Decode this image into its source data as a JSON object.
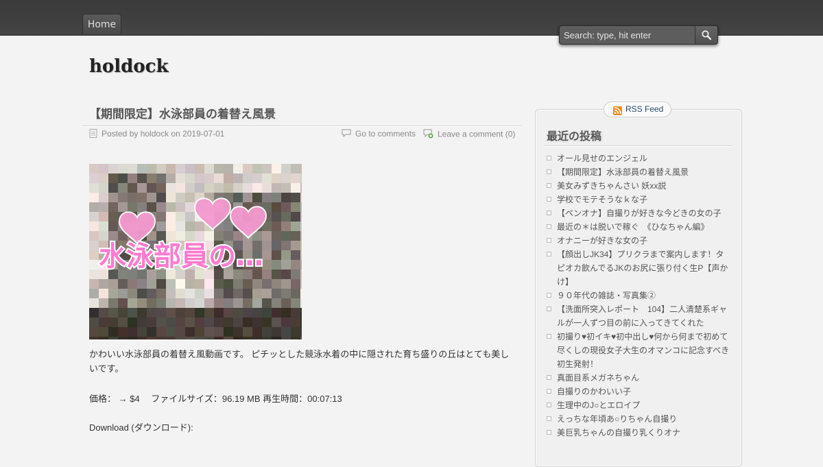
{
  "nav": {
    "home": "Home"
  },
  "search": {
    "placeholder": "Search: type, hit enter"
  },
  "site": {
    "title": "holdock"
  },
  "post": {
    "title": "【期間限定】水泳部員の着替え風景",
    "meta": {
      "posted": "Posted by holdock on 2019-07-01",
      "go_to_comments": "Go to comments",
      "leave_comment": "Leave a comment (0)"
    },
    "image_text": "水泳部員の…",
    "paragraph": "かわいい水泳部員の着替え風動画です。 ピチッとした競泳水着の中に隠された育ち盛りの丘はとても美しいです。",
    "price_line": "価格： → $4　 ファイルサイズ：96.19 MB 再生時間：00:07:13",
    "download": "Download (ダウンロード):"
  },
  "sidebar": {
    "rss": "RSS Feed",
    "widget_title": "最近の投稿",
    "recent_posts": [
      "オール見せのエンジェル",
      "【期間限定】水泳部員の着替え風景",
      "美女みずきちゃんさい 妖xx説",
      "学校でモテそうなｋな子",
      "【ペンオナ】自撮りが好きな今どきの女の子",
      "最近の＊は脱いで稼ぐ　《ひなちゃん編》",
      "オナニーが好きな女の子",
      "【顔出しJK34】プリクラまで案内します！タピオカ飲んでるJKのお尻に張り付く生P【声かけ】",
      "９０年代の雑誌・写真集②",
      "【洗面所突入レポート　104】二人清楚系ギャルが一人ずつ目の前に入ってきてくれた",
      "初撮り♥初イキ♥初中出し♥何から何まで初めて尽くしの現役女子大生のオマンコに記念すべき初生発射！",
      "真面目系メガネちゃん",
      "自撮りのかわいい子",
      "生理中のJ○とエロイプ",
      "えっちな年頃あ○りちゃん自撮り",
      "美巨乳ちゃんの自撮り乳くりオナ"
    ]
  }
}
